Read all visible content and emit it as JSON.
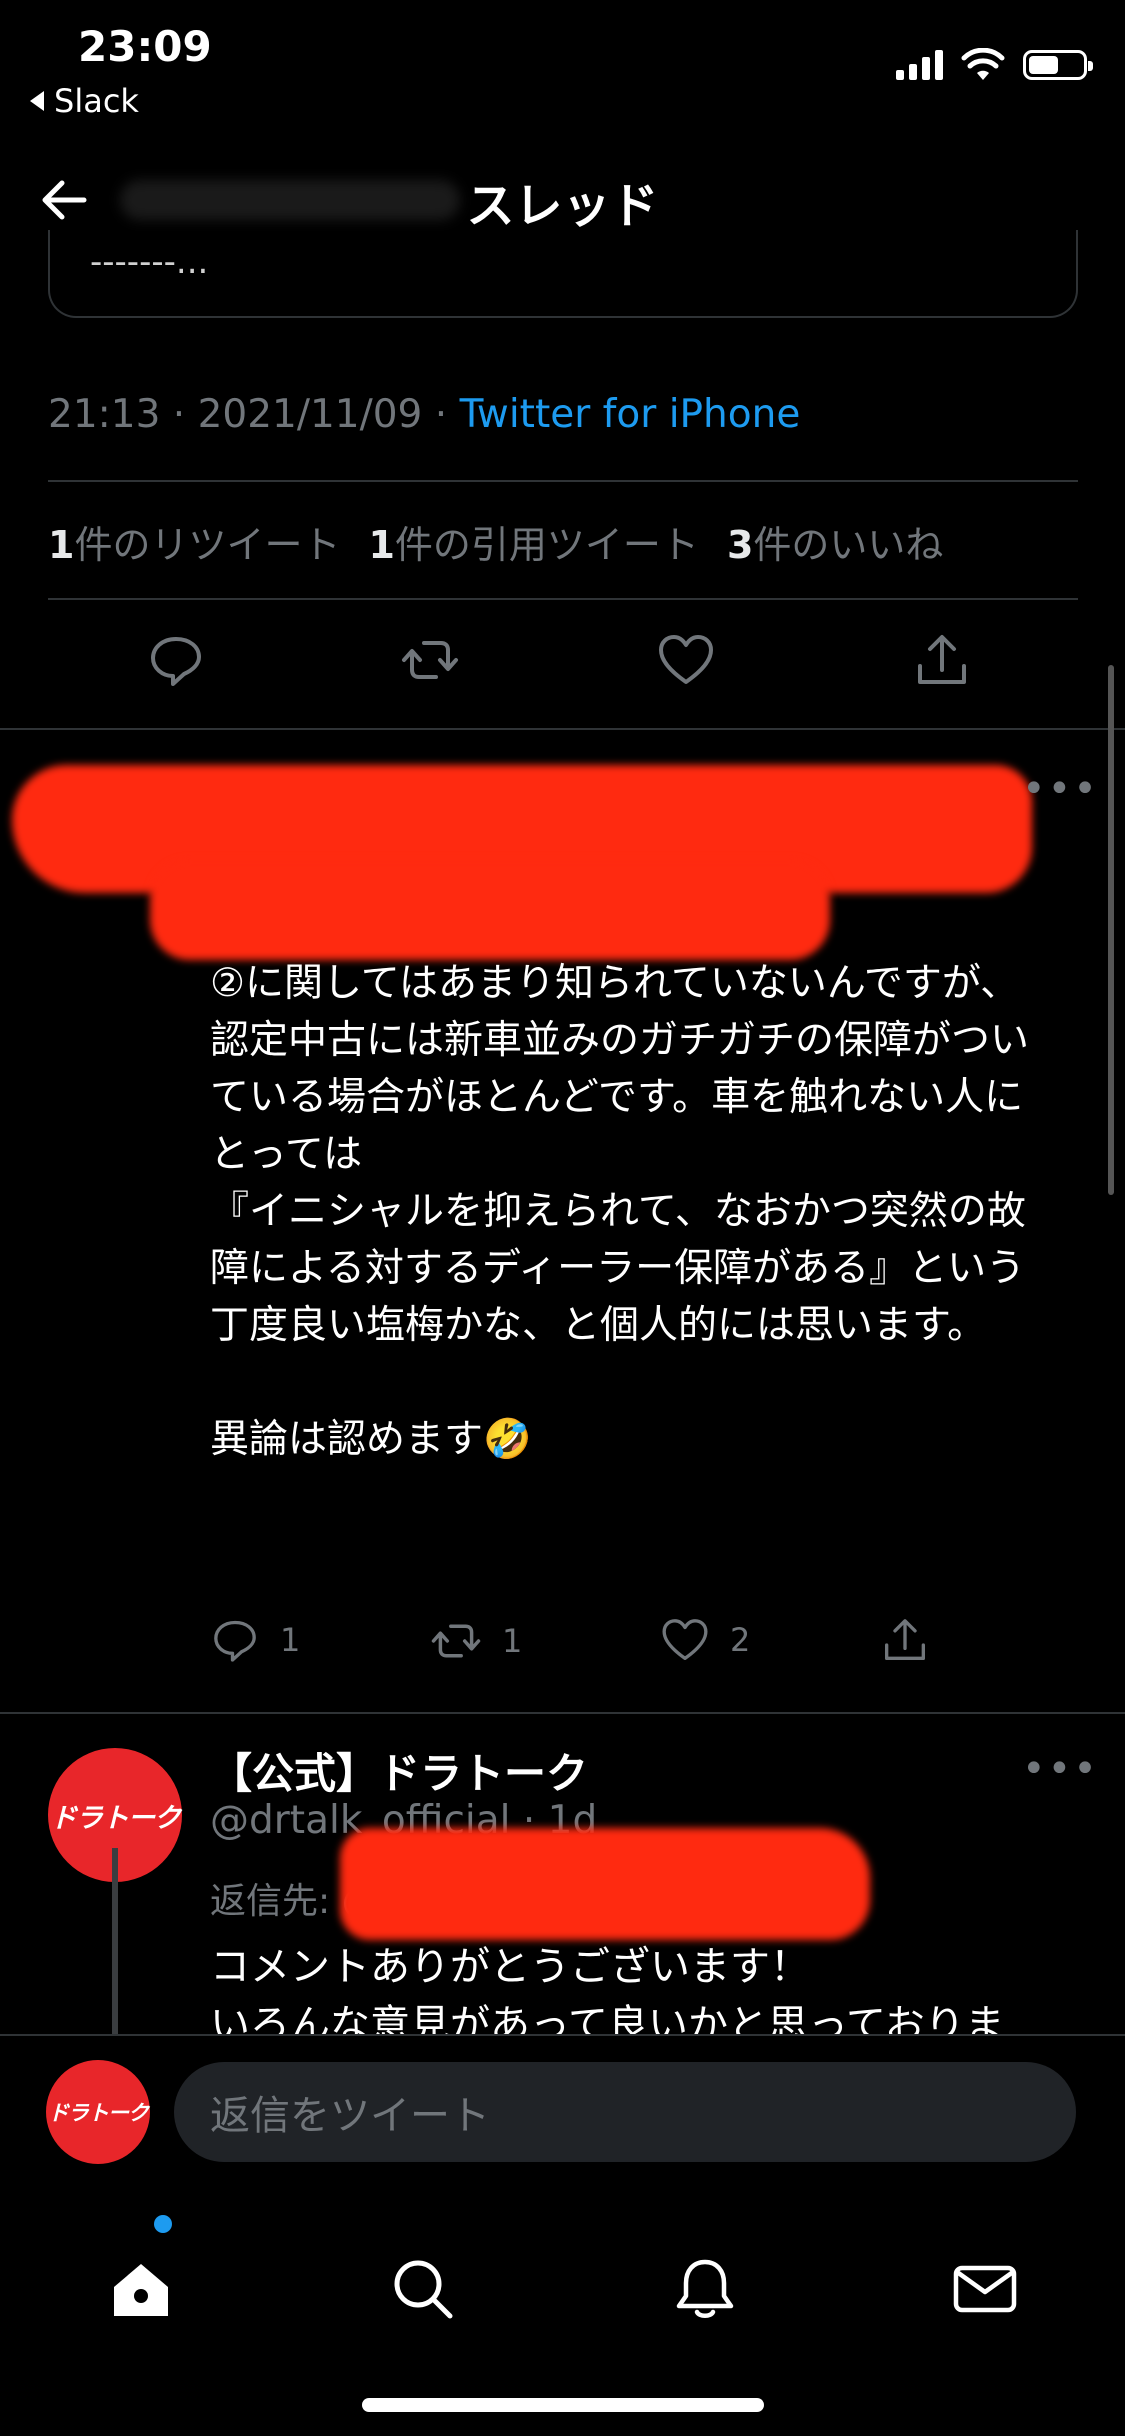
{
  "status_bar": {
    "time": "23:09",
    "back_app": "Slack"
  },
  "header": {
    "title": "スレッド"
  },
  "main_tweet": {
    "quote_snippet": "-------...",
    "meta_time": "21:13 · 2021/11/09 · ",
    "meta_source": "Twitter for iPhone",
    "stats": {
      "retweet_count": "1",
      "retweet_label": "件のリツイート",
      "quote_count": "1",
      "quote_label": "件の引用ツイート",
      "like_count": "3",
      "like_label": "件のいいね"
    }
  },
  "reply1": {
    "text": "②に関してはあまり知られていないんですが、\n認定中古には新車並みのガチガチの保障がついている場合がほとんどです。車を触れない人にとっては\n『イニシャルを抑えられて、なおかつ突然の故障による対するディーラー保障がある』という丁度良い塩梅かな、と個人的には思います。\n\n異論は認めます🤣",
    "reply_count": "1",
    "retweet_count": "1",
    "like_count": "2"
  },
  "reply2": {
    "avatar_text": "ドラトーク",
    "name": "【公式】ドラトーク",
    "handle": "@drtalk_official · 1d",
    "reply_to": "返信先: @",
    "text": "コメントありがとうございます！\nいろんな意見があって良いかと思っておりま"
  },
  "compose": {
    "avatar_text": "ドラトーク",
    "placeholder": "返信をツイート"
  },
  "colors": {
    "background": "#000000",
    "accent": "#1d9bf0",
    "muted": "#71767b",
    "redaction": "#ff2a10",
    "brand_red": "#e8262a"
  }
}
